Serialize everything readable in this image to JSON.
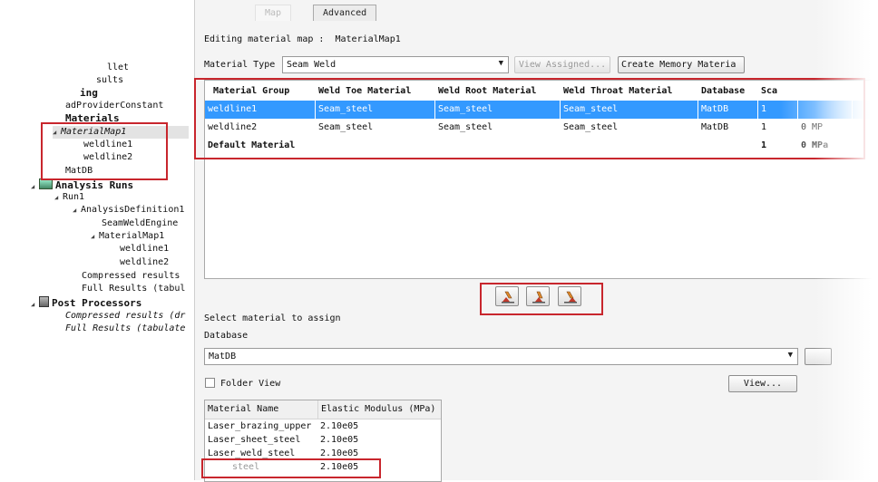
{
  "tabs": [
    {
      "label": "Map"
    },
    {
      "label": "Advanced"
    }
  ],
  "tree": {
    "items": [
      {
        "label": "llet"
      },
      {
        "label": "sults"
      },
      {
        "label": "ing"
      },
      {
        "label": "adProviderConstant"
      },
      {
        "label": "Materials"
      },
      {
        "label": "MaterialMap1"
      },
      {
        "label": "weldline1"
      },
      {
        "label": "weldline2"
      },
      {
        "label": "MatDB"
      },
      {
        "label": "Analysis Runs"
      },
      {
        "label": "Run1"
      },
      {
        "label": "AnalysisDefinition1"
      },
      {
        "label": "SeamWeldEngine"
      },
      {
        "label": "MaterialMap1"
      },
      {
        "label": "weldline1"
      },
      {
        "label": "weldline2"
      },
      {
        "label": "Compressed results"
      },
      {
        "label": "Full Results (tabul"
      },
      {
        "label": "Post Processors"
      },
      {
        "label": "Compressed results (dr"
      },
      {
        "label": "Full Results (tabulate"
      }
    ]
  },
  "editing": {
    "label": "Editing material map :",
    "name": "MaterialMap1"
  },
  "material_type": {
    "label": "Material Type",
    "value": "Seam Weld",
    "view_assigned": "View Assigned...",
    "create_memory": "Create Memory Materia"
  },
  "grid": {
    "headers": [
      "Material Group",
      "Weld Toe Material",
      "Weld Root Material",
      "Weld Throat Material",
      "Database",
      "Sca"
    ],
    "rows": [
      [
        "weldline1",
        "Seam_steel",
        "Seam_steel",
        "Seam_steel",
        "MatDB",
        "1",
        ""
      ],
      [
        "weldline2",
        "Seam_steel",
        "Seam_steel",
        "Seam_steel",
        "MatDB",
        "1",
        "0 MP"
      ],
      [
        "Default Material",
        "",
        "",
        "",
        "",
        "1",
        "0 MPa"
      ]
    ]
  },
  "select_material": {
    "title": "Select material to assign",
    "database_label": "Database",
    "database_value": "MatDB",
    "folder_view": "Folder View",
    "view_button": "View..."
  },
  "material_table": {
    "headers": [
      "Material Name",
      "Elastic Modulus (MPa)"
    ],
    "rows": [
      [
        "Laser_brazing_upper",
        "2.10e05"
      ],
      [
        "Laser_sheet_steel",
        "2.10e05"
      ],
      [
        "Laser_weld_steel",
        "2.10e05"
      ],
      [
        "steel",
        "2.10e05"
      ]
    ]
  },
  "colors": {
    "selection": "#3399ff",
    "highlight_box": "#c8262d"
  }
}
